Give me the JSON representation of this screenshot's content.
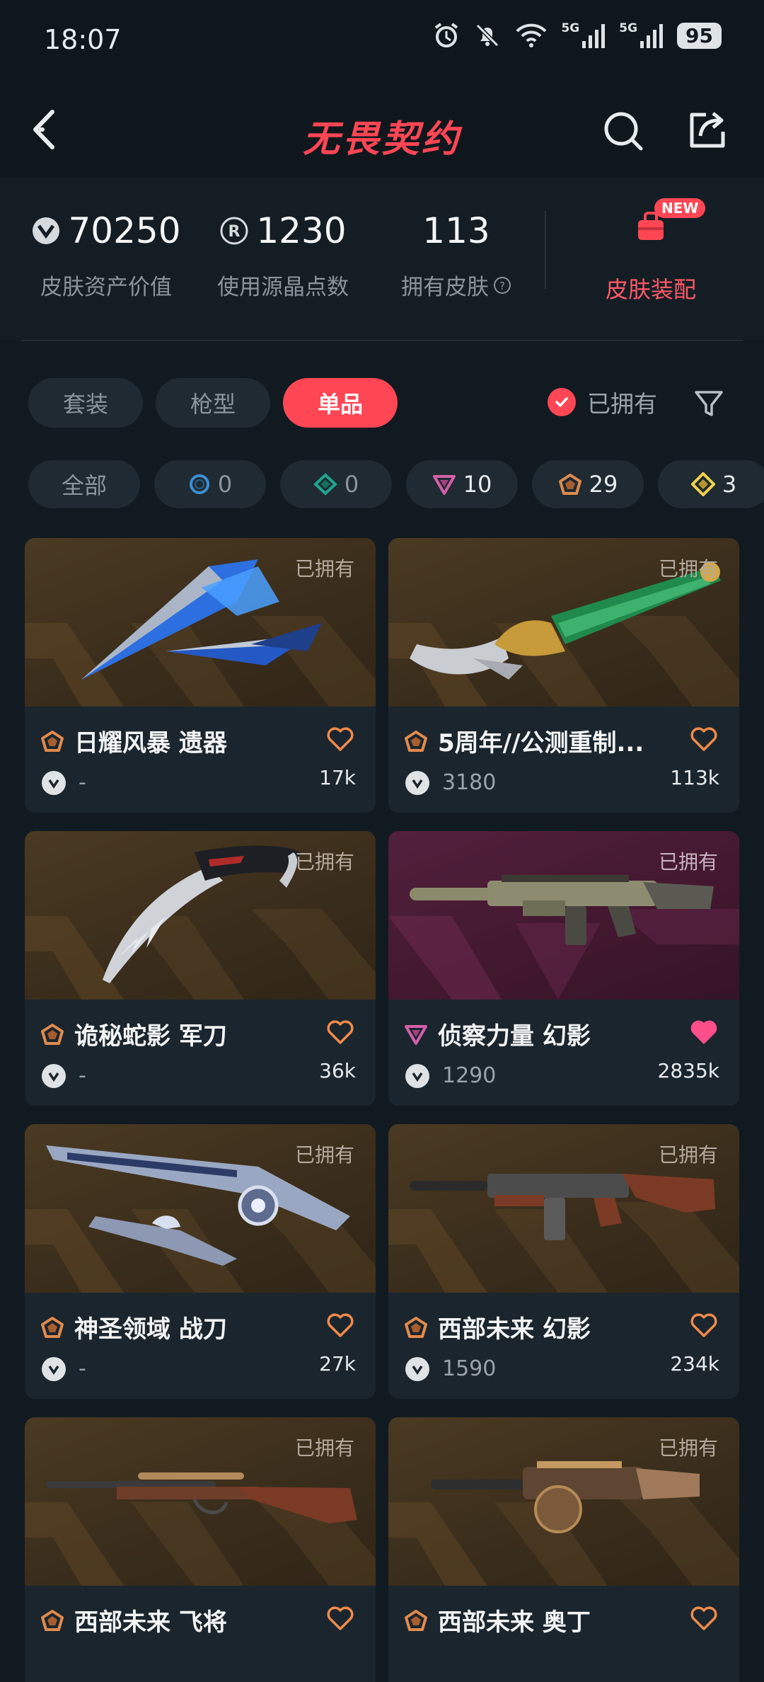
{
  "status": {
    "time": "18:07",
    "net1": "5G",
    "net2": "5G",
    "battery": "95"
  },
  "header": {
    "title": "无畏契约"
  },
  "stats": {
    "asset_value": "70250",
    "asset_value_label": "皮肤资产价值",
    "radianite": "1230",
    "radianite_label": "使用源晶点数",
    "owned_count": "113",
    "owned_label": "拥有皮肤",
    "equip_badge": "NEW",
    "equip_label": "皮肤装配"
  },
  "tabs": [
    {
      "label": "套装",
      "active": false
    },
    {
      "label": "枪型",
      "active": false
    },
    {
      "label": "单品",
      "active": true
    }
  ],
  "owned_filter_label": "已拥有",
  "rarity_chips": [
    {
      "label": "全部"
    },
    {
      "icon": "select-tier-icon",
      "count": "0"
    },
    {
      "icon": "deluxe-tier-icon",
      "count": "0"
    },
    {
      "icon": "exclusive-tier-icon",
      "count": "10"
    },
    {
      "icon": "premium-tier-icon",
      "count": "29"
    },
    {
      "icon": "ultra-tier-icon",
      "count": "3"
    }
  ],
  "accent": "#ff4655",
  "cards": [
    {
      "name": "日耀风暴 遗器",
      "tag": "已拥有",
      "price": "-",
      "likes": "17k",
      "liked": false,
      "bg": "gold",
      "tier": "premium"
    },
    {
      "name": "5周年//公测重制...",
      "tag": "已拥有",
      "price": "3180",
      "likes": "113k",
      "liked": false,
      "bg": "gold",
      "tier": "premium"
    },
    {
      "name": "诡秘蛇影 军刀",
      "tag": "已拥有",
      "price": "-",
      "likes": "36k",
      "liked": false,
      "bg": "gold",
      "tier": "premium"
    },
    {
      "name": "侦察力量 幻影",
      "tag": "已拥有",
      "price": "1290",
      "likes": "2835k",
      "liked": true,
      "bg": "purple",
      "tier": "exclusive"
    },
    {
      "name": "神圣领域 战刀",
      "tag": "已拥有",
      "price": "-",
      "likes": "27k",
      "liked": false,
      "bg": "gold",
      "tier": "premium"
    },
    {
      "name": "西部未来 幻影",
      "tag": "已拥有",
      "price": "1590",
      "likes": "234k",
      "liked": false,
      "bg": "gold",
      "tier": "premium"
    },
    {
      "name": "西部未来 飞将",
      "tag": "已拥有",
      "liked": false,
      "bg": "gold",
      "tier": "premium"
    },
    {
      "name": "西部未来 奥丁",
      "tag": "已拥有",
      "liked": false,
      "bg": "gold",
      "tier": "premium"
    }
  ]
}
